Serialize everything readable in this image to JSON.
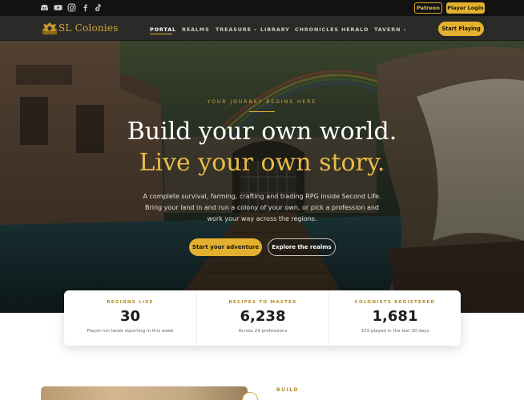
{
  "colors": {
    "accent": "#e3b12f",
    "accent_text": "#d6aa3a",
    "bar_bg": "#121212",
    "nav_bg": "#2a2a28"
  },
  "topbar": {
    "social_icons": [
      "discord-icon",
      "youtube-icon",
      "instagram-icon",
      "facebook-icon",
      "tiktok-icon"
    ],
    "patreon_label": "Patreon",
    "player_login_label": "Player Login"
  },
  "nav": {
    "logo_text": "SL Colonies",
    "items": [
      {
        "label": "PORTAL",
        "active": true
      },
      {
        "label": "REALMS"
      },
      {
        "label": "TREASURE ›"
      },
      {
        "label": "LIBRARY"
      },
      {
        "label": "CHRONICLES"
      },
      {
        "label": "HERALD"
      },
      {
        "label": "TAVERN ›"
      }
    ],
    "cta_label": "Start Playing"
  },
  "hero": {
    "eyebrow": "YOUR JOURNEY BEGINS HERE",
    "headline_1": "Build your own world.",
    "headline_2": "Live your own story.",
    "subtext_lines": [
      "A complete survival, farming, crafting and trading RPG inside Second Life.",
      "Bring your land in and run a colony of your own, or pick a profession and",
      "work your way across the regions."
    ],
    "primary_button": "Start your adventure",
    "secondary_button": "Explore the realms"
  },
  "stats": [
    {
      "label": "REGIONS LIVE",
      "value": "30",
      "note": "Player-run lands reporting in this week"
    },
    {
      "label": "RECIPES TO MASTER",
      "value": "6,238",
      "note": "Across 29 professions"
    },
    {
      "label": "COLONISTS REGISTERED",
      "value": "1,681",
      "note": "103 played in the last 30 days"
    }
  ],
  "section": {
    "label": "BUILD"
  }
}
